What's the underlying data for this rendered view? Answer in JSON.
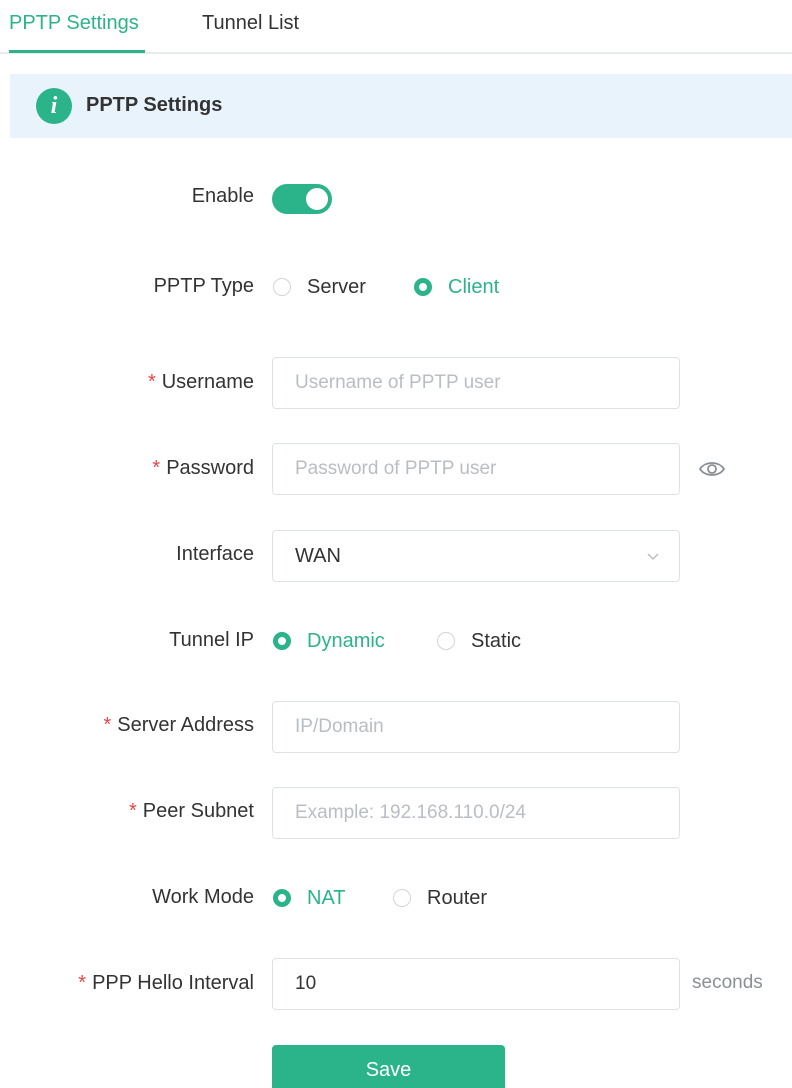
{
  "tabs": [
    {
      "label": "PPTP Settings",
      "active": true
    },
    {
      "label": "Tunnel List",
      "active": false
    }
  ],
  "banner": {
    "title": "PPTP Settings",
    "icon": "info-icon"
  },
  "form": {
    "enable": {
      "label": "Enable",
      "value": true
    },
    "pptp_type": {
      "label": "PPTP Type",
      "options": [
        "Server",
        "Client"
      ],
      "selected": "Client"
    },
    "username": {
      "label": "Username",
      "required": "*",
      "placeholder": "Username of PPTP user",
      "value": ""
    },
    "password": {
      "label": "Password",
      "required": "*",
      "placeholder": "Password of PPTP user",
      "value": "",
      "icon": "eye-icon"
    },
    "interface": {
      "label": "Interface",
      "value": "WAN"
    },
    "tunnel_ip": {
      "label": "Tunnel IP",
      "options": [
        "Dynamic",
        "Static"
      ],
      "selected": "Dynamic"
    },
    "server_address": {
      "label": "Server Address",
      "required": "*",
      "placeholder": "IP/Domain",
      "value": ""
    },
    "peer_subnet": {
      "label": "Peer Subnet",
      "required": "*",
      "placeholder": "Example: 192.168.110.0/24",
      "value": ""
    },
    "work_mode": {
      "label": "Work Mode",
      "options": [
        "NAT",
        "Router"
      ],
      "selected": "NAT"
    },
    "ppp_hello_interval": {
      "label": "PPP Hello Interval",
      "required": "*",
      "value": "10",
      "suffix": "seconds"
    }
  },
  "save_label": "Save",
  "colors": {
    "accent": "#2bb38a",
    "required": "#e84545",
    "banner_bg": "#e8f3fb"
  }
}
